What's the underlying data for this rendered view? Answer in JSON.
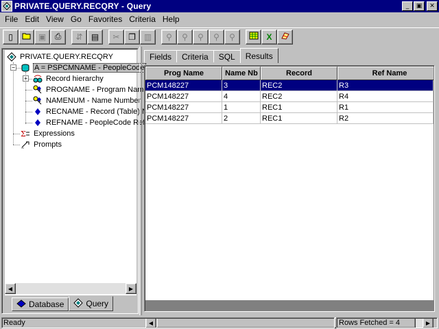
{
  "window": {
    "title": "PRIVATE.QUERY.RECQRY - Query",
    "minimize": "_",
    "restore": "▣",
    "close": "✕"
  },
  "menu": [
    "File",
    "Edit",
    "View",
    "Go",
    "Favorites",
    "Criteria",
    "Help"
  ],
  "toolbar": {
    "buttons": [
      {
        "icon": "new-icon",
        "glyph": "▯"
      },
      {
        "icon": "open-icon",
        "glyph": "📂"
      },
      {
        "icon": "save-icon",
        "glyph": "▣"
      },
      {
        "icon": "print-icon",
        "glyph": "⎙"
      },
      {
        "icon": "rename-icon",
        "glyph": "⇵"
      },
      {
        "icon": "properties-icon",
        "glyph": "▤"
      },
      {
        "icon": "cut-icon",
        "glyph": "✂"
      },
      {
        "icon": "copy-icon",
        "glyph": "❐"
      },
      {
        "icon": "paste-icon",
        "glyph": "▥"
      },
      {
        "icon": "filter-icon",
        "glyph": "⚲"
      },
      {
        "icon": "filter-add-icon",
        "glyph": "⚲"
      },
      {
        "icon": "filter-edit-icon",
        "glyph": "⚲"
      },
      {
        "icon": "filter-group-icon",
        "glyph": "⚲"
      },
      {
        "icon": "filter-remove-icon",
        "glyph": "⚲"
      },
      {
        "icon": "run-query-icon",
        "glyph": "▦"
      },
      {
        "icon": "excel-icon",
        "glyph": "X"
      },
      {
        "icon": "crystal-icon",
        "glyph": "◪"
      }
    ]
  },
  "tree": {
    "root": "PRIVATE.QUERY.RECQRY",
    "record": "A = PSPCMNAME - PeopleCode",
    "items": [
      "Record hierarchy",
      "PROGNAME - Program Name",
      "NAMENUM - Name Number",
      "RECNAME - Record (Table) Name",
      "REFNAME - PeopleCode Ref"
    ],
    "expressions": "Expressions",
    "prompts": "Prompts",
    "expander_minus": "−",
    "expander_plus": "+"
  },
  "left_tabs": [
    "Database",
    "Query"
  ],
  "right_tabs": [
    "Fields",
    "Criteria",
    "SQL",
    "Results"
  ],
  "results": {
    "columns": [
      "Prog Name",
      "Name Nb",
      "Record",
      "Ref Name"
    ],
    "rows": [
      [
        "PCM148227",
        "3",
        "REC2",
        "R3"
      ],
      [
        "PCM148227",
        "4",
        "REC2",
        "R4"
      ],
      [
        "PCM148227",
        "1",
        "REC1",
        "R1"
      ],
      [
        "PCM148227",
        "2",
        "REC1",
        "R2"
      ]
    ],
    "selected_row": 0
  },
  "scroll": {
    "left": "◀",
    "right": "▶"
  },
  "status": {
    "left": "Ready",
    "right": "Rows Fetched = 4"
  },
  "colors": {
    "title_bar": "#000080",
    "selection": "#000080",
    "face": "#c0c0c0"
  }
}
